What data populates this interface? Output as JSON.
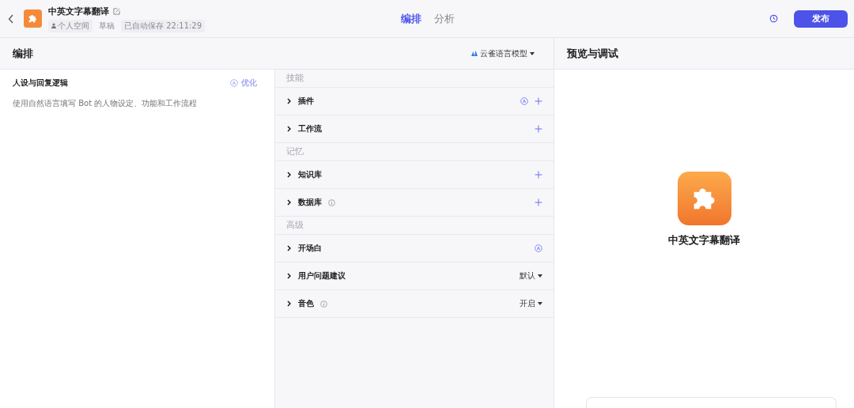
{
  "header": {
    "title": "中英文字幕翻译",
    "space": "个人空间",
    "status": "草稿",
    "autosave": "已自动保存 22:11:29",
    "publish": "发布"
  },
  "tabs": [
    {
      "label": "编排",
      "selected": true
    },
    {
      "label": "分析",
      "selected": false
    }
  ],
  "arrange": {
    "title": "编排",
    "model": "云雀语言模型"
  },
  "persona": {
    "title": "人设与回复逻辑",
    "optimize": "优化",
    "placeholder": "使用自然语言填写 Bot 的人物设定、功能和工作流程"
  },
  "sections": [
    {
      "title": "技能",
      "items": [
        {
          "label": "插件",
          "expanded": false,
          "info": false,
          "auto": true,
          "add": true
        },
        {
          "label": "工作流",
          "expanded": false,
          "info": false,
          "auto": false,
          "add": true
        }
      ]
    },
    {
      "title": "记忆",
      "items": [
        {
          "label": "知识库",
          "expanded": false,
          "info": false,
          "auto": false,
          "add": true
        },
        {
          "label": "数据库",
          "expanded": false,
          "info": true,
          "auto": false,
          "add": true
        }
      ]
    },
    {
      "title": "高级",
      "items": [
        {
          "label": "开场白",
          "expanded": false,
          "info": false,
          "auto": true,
          "add": false
        },
        {
          "label": "用户问题建议",
          "expanded": false,
          "info": false,
          "auto": false,
          "add": false,
          "value": "默认"
        },
        {
          "label": "音色",
          "expanded": false,
          "info": true,
          "auto": false,
          "add": false,
          "value": "开启"
        }
      ]
    }
  ],
  "preview": {
    "title": "预览与调试",
    "bot_name": "中英文字幕翻译"
  }
}
